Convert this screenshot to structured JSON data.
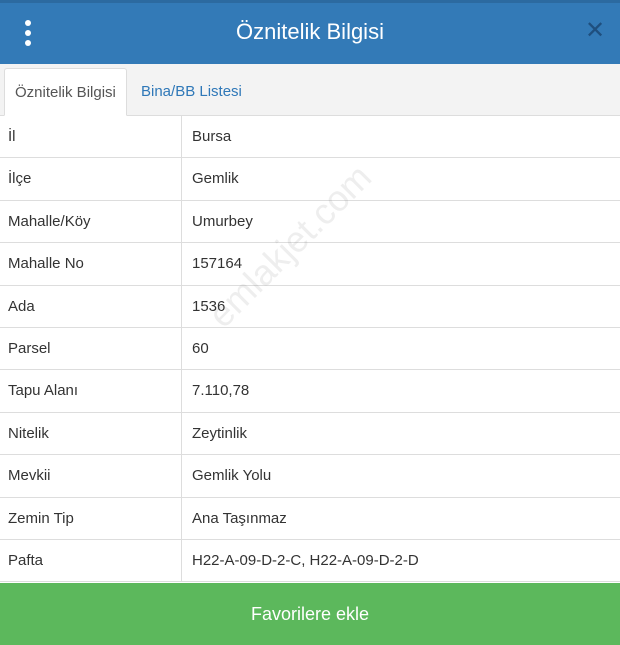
{
  "header": {
    "title": "Öznitelik Bilgisi",
    "menu_icon": "vertical-dots-icon",
    "close_icon": "close-icon",
    "background_color": "#337ab7"
  },
  "tabs": [
    {
      "label": "Öznitelik Bilgisi",
      "active": true
    },
    {
      "label": "Bina/BB Listesi",
      "active": false
    }
  ],
  "rows": [
    {
      "key": "İl",
      "value": "Bursa"
    },
    {
      "key": "İlçe",
      "value": "Gemlik"
    },
    {
      "key": "Mahalle/Köy",
      "value": "Umurbey"
    },
    {
      "key": "Mahalle No",
      "value": "157164"
    },
    {
      "key": "Ada",
      "value": "1536"
    },
    {
      "key": "Parsel",
      "value": "60"
    },
    {
      "key": "Tapu Alanı",
      "value": "7.110,78"
    },
    {
      "key": "Nitelik",
      "value": "Zeytinlik"
    },
    {
      "key": "Mevkii",
      "value": "Gemlik Yolu"
    },
    {
      "key": "Zemin Tip",
      "value": "Ana Taşınmaz"
    },
    {
      "key": "Pafta",
      "value": "H22-A-09-D-2-C, H22-A-09-D-2-D"
    }
  ],
  "watermark": "emlakjet.com",
  "footer": {
    "button_label": "Favorilere ekle",
    "button_color": "#5cb85c"
  }
}
